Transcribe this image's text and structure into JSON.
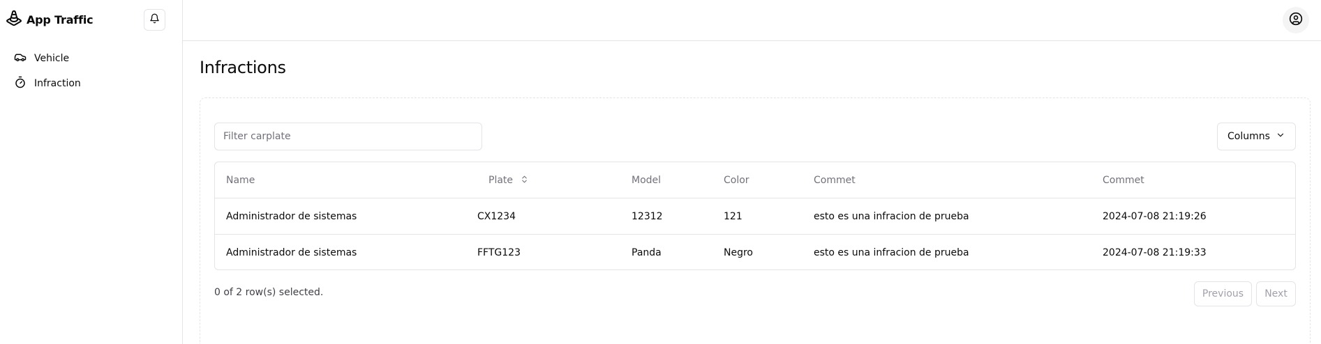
{
  "app": {
    "name": "App Traffic"
  },
  "sidebar": {
    "items": [
      {
        "label": "Vehicle",
        "icon": "car-icon"
      },
      {
        "label": "Infraction",
        "icon": "timer-icon"
      }
    ]
  },
  "page": {
    "title": "Infractions"
  },
  "filter": {
    "placeholder": "Filter carplate",
    "value": ""
  },
  "toolbar": {
    "columns_label": "Columns"
  },
  "table": {
    "headers": [
      "Name",
      "Plate",
      "Model",
      "Color",
      "Commet",
      "Commet"
    ],
    "rows": [
      [
        "Administrador de sistemas",
        "CX1234",
        "12312",
        "121",
        "esto es una infracion de prueba",
        "2024-07-08 21:19:26"
      ],
      [
        "Administrador de sistemas",
        "FFTG123",
        "Panda",
        "Negro",
        "esto es una infracion de prueba",
        "2024-07-08 21:19:33"
      ]
    ]
  },
  "footer": {
    "selected_text": "0 of 2 row(s) selected.",
    "previous_label": "Previous",
    "next_label": "Next"
  }
}
